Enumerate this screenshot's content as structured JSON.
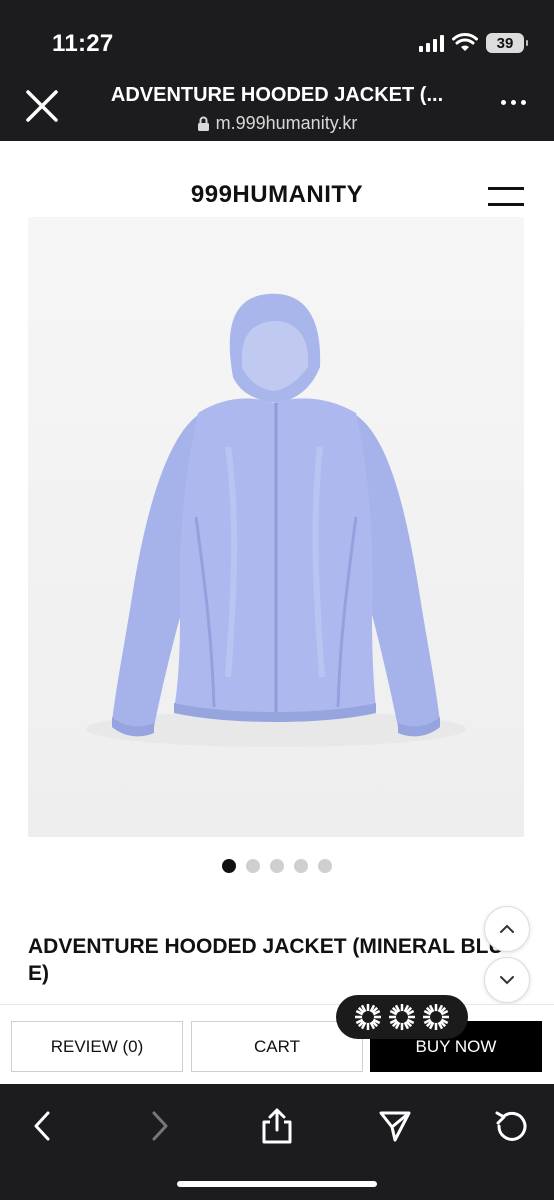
{
  "status_bar": {
    "time": "11:27",
    "battery": "39"
  },
  "browser": {
    "page_title": "ADVENTURE HOODED JACKET (...",
    "url": "m.999humanity.kr"
  },
  "site": {
    "brand": "999HUMANITY"
  },
  "product": {
    "name": "ADVENTURE HOODED JACKET (MINERAL BLUE)",
    "image_icon": "product-photo-jacket",
    "jacket_color": "#aab8ef",
    "carousel": {
      "total": 5,
      "active": 1
    }
  },
  "actions": {
    "review_label": "REVIEW (0)",
    "cart_label": "CART",
    "buy_label": "BUY NOW"
  },
  "icons": {
    "close": "close-icon",
    "more": "more-icon",
    "menu": "hamburger-icon",
    "lock": "lock-icon",
    "scroll_up": "chevron-up-icon",
    "scroll_down": "chevron-down-icon",
    "back": "chevron-left-icon",
    "forward": "chevron-right-icon",
    "share": "share-icon",
    "send": "send-icon",
    "reload": "reload-icon"
  },
  "colors": {
    "chrome_bg": "#1c1c1e",
    "buy_bg": "#000000"
  }
}
